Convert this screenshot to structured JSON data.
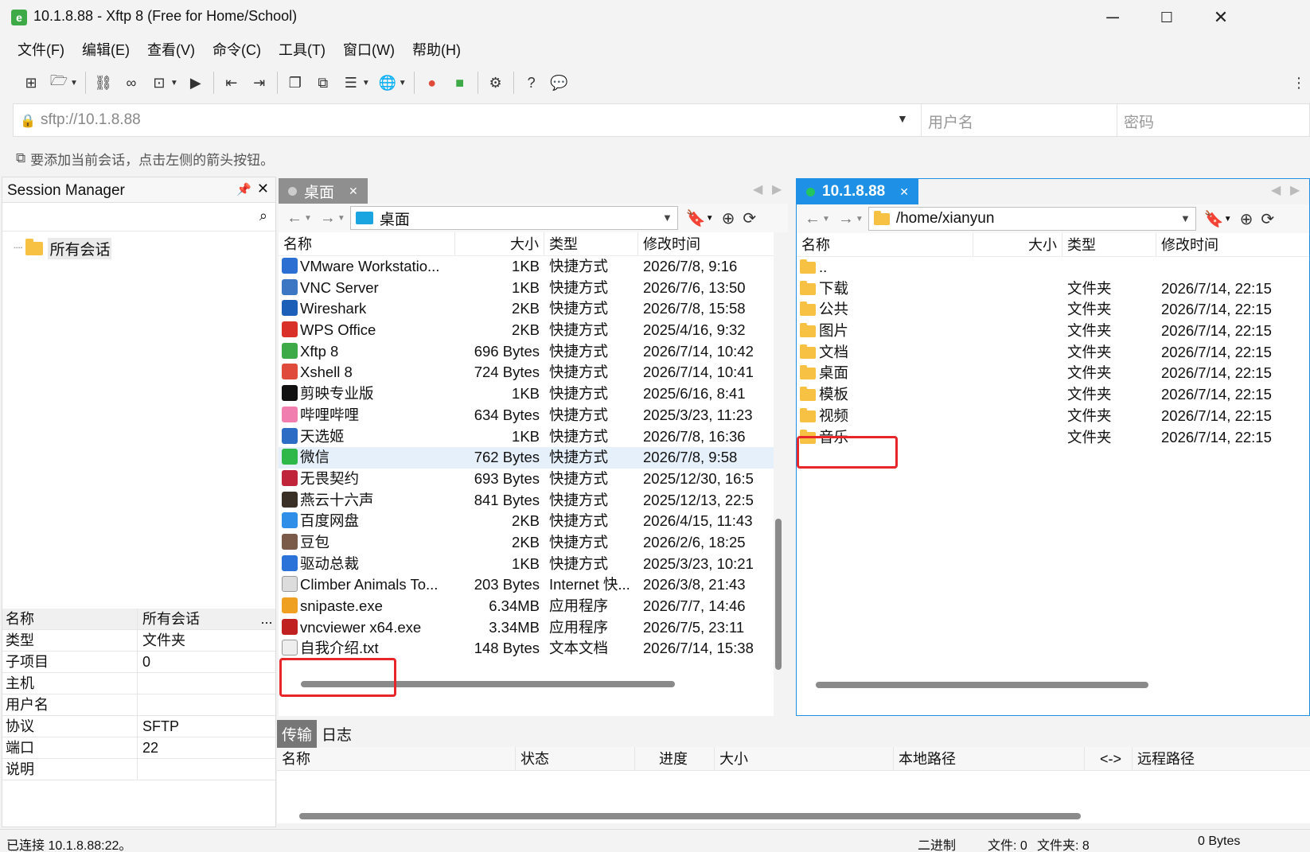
{
  "window": {
    "title": "10.1.8.88 - Xftp 8 (Free for Home/School)",
    "minimize": "─",
    "maximize": "☐",
    "close": "✕"
  },
  "menu": [
    "文件(F)",
    "编辑(E)",
    "查看(V)",
    "命令(C)",
    "工具(T)",
    "窗口(W)",
    "帮助(H)"
  ],
  "address": {
    "url": "sftp://10.1.8.88",
    "username_placeholder": "用户名",
    "password_placeholder": "密码"
  },
  "hint": "要添加当前会话，点击左侧的箭头按钮。",
  "session_manager": {
    "title": "Session Manager",
    "tree_root": "所有会话",
    "props": [
      {
        "k": "名称",
        "v": "所有会话",
        "extra": "..."
      },
      {
        "k": "类型",
        "v": "文件夹"
      },
      {
        "k": "子项目",
        "v": "0"
      },
      {
        "k": "主机",
        "v": ""
      },
      {
        "k": "用户名",
        "v": ""
      },
      {
        "k": "协议",
        "v": "SFTP"
      },
      {
        "k": "端口",
        "v": "22"
      },
      {
        "k": "说明",
        "v": ""
      }
    ]
  },
  "local": {
    "tab": "桌面",
    "path": "桌面",
    "columns": [
      "名称",
      "大小",
      "类型",
      "修改时间"
    ],
    "files": [
      {
        "name": "VMware Workstatio...",
        "size": "1KB",
        "type": "快捷方式",
        "mtime": "2026/7/8, 9:16",
        "color": "#2a6fd1"
      },
      {
        "name": "VNC Server",
        "size": "1KB",
        "type": "快捷方式",
        "mtime": "2026/7/6, 13:50",
        "color": "#3b77c2"
      },
      {
        "name": "Wireshark",
        "size": "2KB",
        "type": "快捷方式",
        "mtime": "2026/7/8, 15:58",
        "color": "#1c5fb8"
      },
      {
        "name": "WPS Office",
        "size": "2KB",
        "type": "快捷方式",
        "mtime": "2025/4/16, 9:32",
        "color": "#d9302a"
      },
      {
        "name": "Xftp 8",
        "size": "696 Bytes",
        "type": "快捷方式",
        "mtime": "2026/7/14, 10:42",
        "color": "#3daa47"
      },
      {
        "name": "Xshell 8",
        "size": "724 Bytes",
        "type": "快捷方式",
        "mtime": "2026/7/14, 10:41",
        "color": "#e04a3a"
      },
      {
        "name": "剪映专业版",
        "size": "1KB",
        "type": "快捷方式",
        "mtime": "2025/6/16, 8:41",
        "color": "#111111"
      },
      {
        "name": "哔哩哔哩",
        "size": "634 Bytes",
        "type": "快捷方式",
        "mtime": "2025/3/23, 11:23",
        "color": "#f07eae"
      },
      {
        "name": "天选姬",
        "size": "1KB",
        "type": "快捷方式",
        "mtime": "2026/7/8, 16:36",
        "color": "#2c6cc4"
      },
      {
        "name": "微信",
        "size": "762 Bytes",
        "type": "快捷方式",
        "mtime": "2026/7/8, 9:58",
        "color": "#2fb84a"
      },
      {
        "name": "无畏契约",
        "size": "693 Bytes",
        "type": "快捷方式",
        "mtime": "2025/12/30, 16:5",
        "color": "#c0243a"
      },
      {
        "name": "燕云十六声",
        "size": "841 Bytes",
        "type": "快捷方式",
        "mtime": "2025/12/13, 22:5",
        "color": "#3a3026"
      },
      {
        "name": "百度网盘",
        "size": "2KB",
        "type": "快捷方式",
        "mtime": "2026/4/15, 11:43",
        "color": "#2f8ee8"
      },
      {
        "name": "豆包",
        "size": "2KB",
        "type": "快捷方式",
        "mtime": "2026/2/6, 18:25",
        "color": "#7a5a48"
      },
      {
        "name": "驱动总裁",
        "size": "1KB",
        "type": "快捷方式",
        "mtime": "2025/3/23, 10:21",
        "color": "#2b73d8"
      },
      {
        "name": "Climber Animals To...",
        "size": "203 Bytes",
        "type": "Internet 快...",
        "mtime": "2026/3/8, 21:43",
        "color": "#dcdcdc"
      },
      {
        "name": "snipaste.exe",
        "size": "6.34MB",
        "type": "应用程序",
        "mtime": "2026/7/7, 14:46",
        "color": "#f0a020"
      },
      {
        "name": "vncviewer x64.exe",
        "size": "3.34MB",
        "type": "应用程序",
        "mtime": "2026/7/5, 23:11",
        "color": "#c02020"
      },
      {
        "name": "自我介绍.txt",
        "size": "148 Bytes",
        "type": "文本文档",
        "mtime": "2026/7/14, 15:38",
        "color": "#eeeeee"
      }
    ]
  },
  "remote": {
    "tab": "10.1.8.88",
    "path": "/home/xianyun",
    "columns": [
      "名称",
      "大小",
      "类型",
      "修改时间"
    ],
    "files": [
      {
        "name": "..",
        "size": "",
        "type": "",
        "mtime": ""
      },
      {
        "name": "下载",
        "size": "",
        "type": "文件夹",
        "mtime": "2026/7/14, 22:15"
      },
      {
        "name": "公共",
        "size": "",
        "type": "文件夹",
        "mtime": "2026/7/14, 22:15"
      },
      {
        "name": "图片",
        "size": "",
        "type": "文件夹",
        "mtime": "2026/7/14, 22:15"
      },
      {
        "name": "文档",
        "size": "",
        "type": "文件夹",
        "mtime": "2026/7/14, 22:15"
      },
      {
        "name": "桌面",
        "size": "",
        "type": "文件夹",
        "mtime": "2026/7/14, 22:15"
      },
      {
        "name": "模板",
        "size": "",
        "type": "文件夹",
        "mtime": "2026/7/14, 22:15"
      },
      {
        "name": "视频",
        "size": "",
        "type": "文件夹",
        "mtime": "2026/7/14, 22:15"
      },
      {
        "name": "音乐",
        "size": "",
        "type": "文件夹",
        "mtime": "2026/7/14, 22:15"
      }
    ]
  },
  "transfer": {
    "tabs": [
      "传输",
      "日志"
    ],
    "columns": [
      "名称",
      "状态",
      "进度",
      "大小",
      "本地路径",
      "<->",
      "远程路径"
    ]
  },
  "status": {
    "connection": "已连接 10.1.8.88:22。",
    "mode": "二进制",
    "files": "文件: 0",
    "folders": "文件夹: 8",
    "bytes": "0 Bytes"
  },
  "colors": {
    "accent": "#1e90e6",
    "highlight": "#e8262a",
    "online": "#22c55e"
  }
}
